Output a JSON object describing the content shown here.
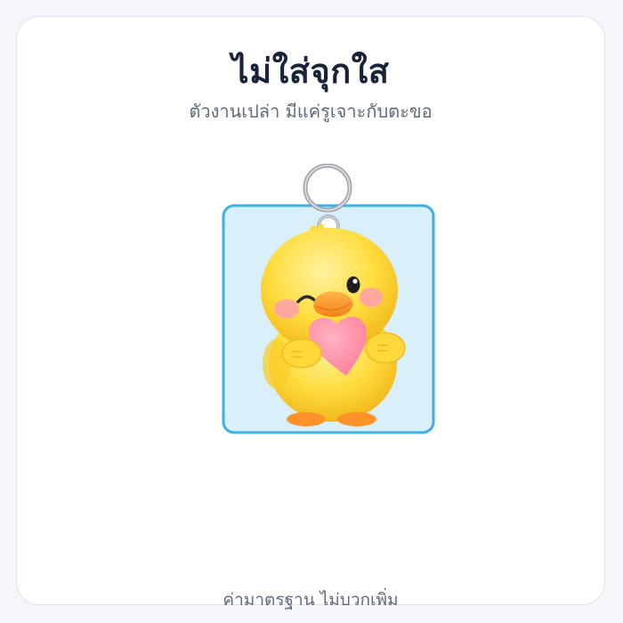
{
  "product": {
    "title": "ไม่ใส่จุกใส",
    "subtitle": "ตัวงานเปล่า มีแค่รูเจาะกับตะขอ",
    "price_note": "ค่ามาตรฐาน ไม่บวกเพิ่ม"
  },
  "preview": {
    "image": "yellow-duckling-holding-pink-heart",
    "hardware": "silver-key-ring",
    "frame_color": "#3fb0e6",
    "background_color": "#d9eff9"
  },
  "colors": {
    "title": "#17243a",
    "subtitle": "#5d6b7c",
    "duck": "#ffd93a",
    "heart": "#ff8aa3",
    "beak": "#ff9b2e"
  }
}
